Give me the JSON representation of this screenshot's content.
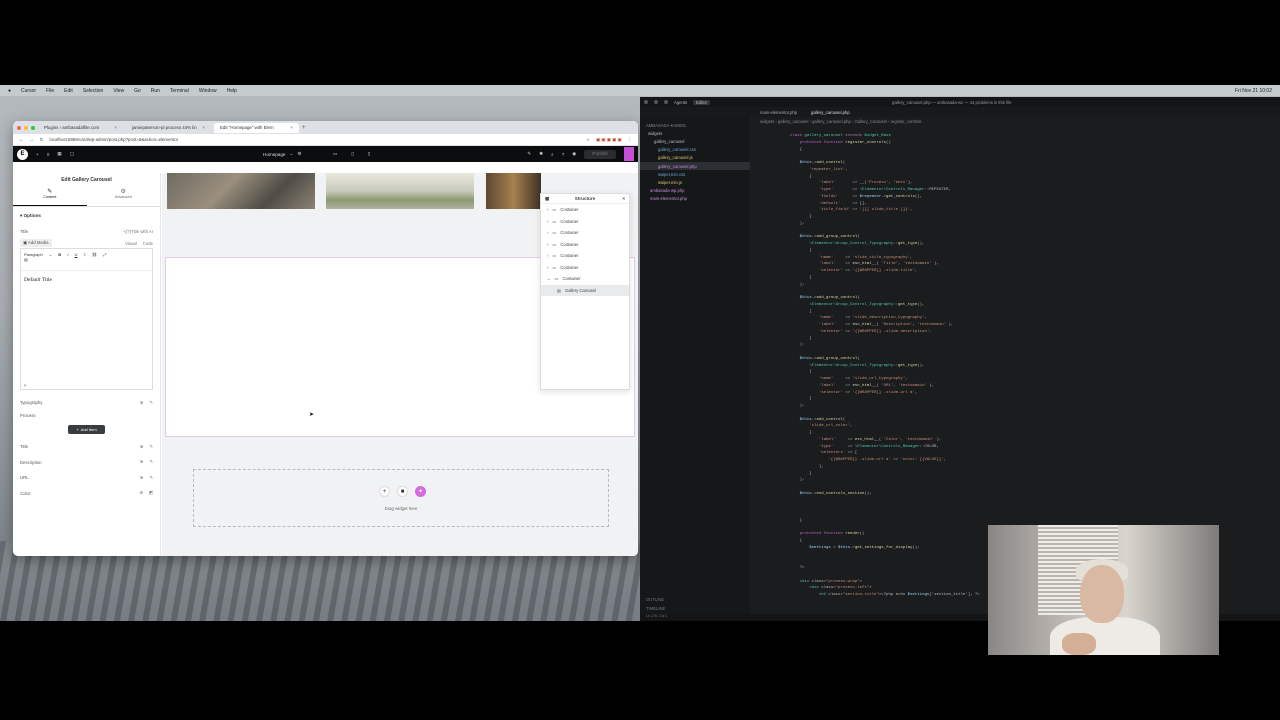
{
  "menubar": {
    "items": [
      "Cursor",
      "File",
      "Edit",
      "Selection",
      "View",
      "Go",
      "Run",
      "Terminal",
      "Window",
      "Help"
    ],
    "clock": "Fri Nov 21 10:02"
  },
  "browser": {
    "tabs": [
      {
        "label": "Plugins ‹ ambasadaflite.com",
        "active": false
      },
      {
        "label": "jamiepaterson-pl process 44% lin",
        "active": false
      },
      {
        "label": "Edit \"Homepage\" with Elem",
        "active": true
      }
    ],
    "url": "localhost:8888/carolwp-admin/post.php?post=8&action=elementor",
    "page_selector": "Homepage",
    "publish_label": "Publish"
  },
  "panel": {
    "title": "Edit Gallery Carousel",
    "tabs": [
      "Content",
      "Advanced"
    ],
    "section": "Options",
    "title_label": "Title",
    "title_dynamic": "<{?}Title with AI",
    "add_media": "Add Media",
    "editor_modes": [
      "Visual",
      "Code"
    ],
    "paragraph": "Paragraph",
    "editor_text": "Default Title",
    "editor_status": "P",
    "typography_label": "Typography",
    "process_label": "Process",
    "add_item": "Add Item",
    "fields": [
      "Title",
      "Description",
      "URL",
      "Color"
    ]
  },
  "canvas": {
    "drag_widget": "Drag widget here",
    "structure_title": "Structure",
    "structure_items": [
      "Container",
      "Container",
      "Container",
      "Container",
      "Container",
      "Container",
      "Container"
    ],
    "structure_child": "Gallery Carousel"
  },
  "code": {
    "title": "gallery_carousel.php — ambasada-wc — 42 problems in this file",
    "left_tabs": [
      "Agents",
      "Editor"
    ],
    "tabs": [
      "main-elementor.php",
      "gallery_carousel.php"
    ],
    "breadcrumb": "widgets › gallery_carousel › gallery_carousel.php › Gallery_Carousel › register_controls",
    "explorer_root": "AMBASADA-KAMOS",
    "explorer": [
      "widgets",
      "gallery_carousel",
      "gallery_carousel.css",
      "gallery_carousel.js",
      "gallery_carousel.php",
      "swiper.min.css",
      "swiper.min.js",
      "ambasada-wp.php",
      "main-elementor.php"
    ],
    "outline": "OUTLINE",
    "timeline": "TIMELINE",
    "statusbar": "Ln 176, Col 1"
  }
}
